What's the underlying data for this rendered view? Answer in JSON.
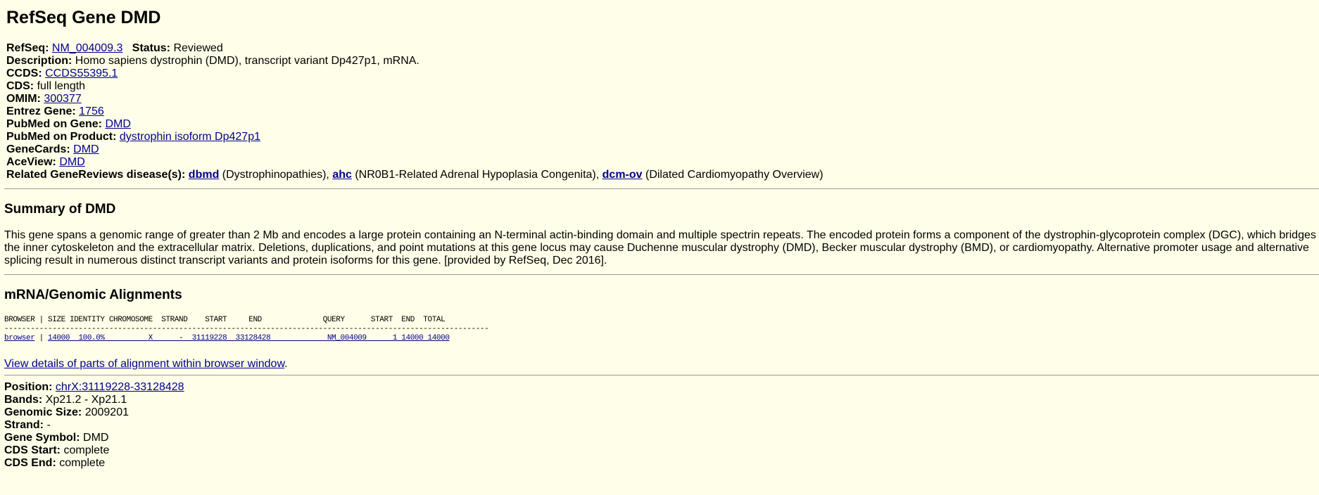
{
  "title": "RefSeq Gene DMD",
  "info": {
    "refseq_label": "RefSeq:",
    "refseq_value": "NM_004009.3",
    "status_label": "Status:",
    "status_value": "Reviewed",
    "description_label": "Description:",
    "description_value": "Homo sapiens dystrophin (DMD), transcript variant Dp427p1, mRNA.",
    "ccds_label": "CCDS:",
    "ccds_value": "CCDS55395.1",
    "cds_label": "CDS:",
    "cds_value": "full length",
    "omim_label": "OMIM:",
    "omim_value": "300377",
    "entrez_label": "Entrez Gene:",
    "entrez_value": "1756",
    "pubmed_gene_label": "PubMed on Gene:",
    "pubmed_gene_value": "DMD",
    "pubmed_product_label": "PubMed on Product:",
    "pubmed_product_value": "dystrophin isoform Dp427p1",
    "genecards_label": "GeneCards:",
    "genecards_value": "DMD",
    "aceview_label": "AceView:",
    "aceview_value": "DMD",
    "genereviews_label": "Related GeneReviews disease(s):",
    "genereviews": [
      {
        "link": "dbmd",
        "desc": " (Dystrophinopathies), "
      },
      {
        "link": "ahc",
        "desc": " (NR0B1-Related Adrenal Hypoplasia Congenita), "
      },
      {
        "link": "dcm-ov",
        "desc": " (Dilated Cardiomyopathy Overview)"
      }
    ]
  },
  "summary": {
    "heading": "Summary of DMD",
    "text": "This gene spans a genomic range of greater than 2 Mb and encodes a large protein containing an N-terminal actin-binding domain and multiple spectrin repeats. The encoded protein forms a component of the dystrophin-glycoprotein complex (DGC), which bridges the inner cytoskeleton and the extracellular matrix. Deletions, duplications, and point mutations at this gene locus may cause Duchenne muscular dystrophy (DMD), Becker muscular dystrophy (BMD), or cardiomyopathy. Alternative promoter usage and alternative splicing result in numerous distinct transcript variants and protein isoforms for this gene. [provided by RefSeq, Dec 2016]."
  },
  "alignments": {
    "heading": "mRNA/Genomic Alignments",
    "header_line": "BROWSER | SIZE IDENTITY CHROMOSOME  STRAND    START     END              QUERY      START  END  TOTAL",
    "dash_line": "---------------------------------------------------------------------------------------------------------------",
    "row_browser": "browser",
    "row_sep": " | ",
    "row_rest": "14000  100.0%          X      -  31119228  33128428             NM_004009      1 14000 14000",
    "view_details": "View details of parts of alignment within browser window",
    "view_details_suffix": "."
  },
  "position": {
    "position_label": "Position:",
    "position_value": "chrX:31119228-33128428",
    "bands_label": "Bands:",
    "bands_value": "Xp21.2 - Xp21.1",
    "genomic_size_label": "Genomic Size:",
    "genomic_size_value": "2009201",
    "strand_label": "Strand:",
    "strand_value": "-",
    "gene_symbol_label": "Gene Symbol:",
    "gene_symbol_value": "DMD",
    "cds_start_label": "CDS Start:",
    "cds_start_value": "complete",
    "cds_end_label": "CDS End:",
    "cds_end_value": "complete"
  }
}
